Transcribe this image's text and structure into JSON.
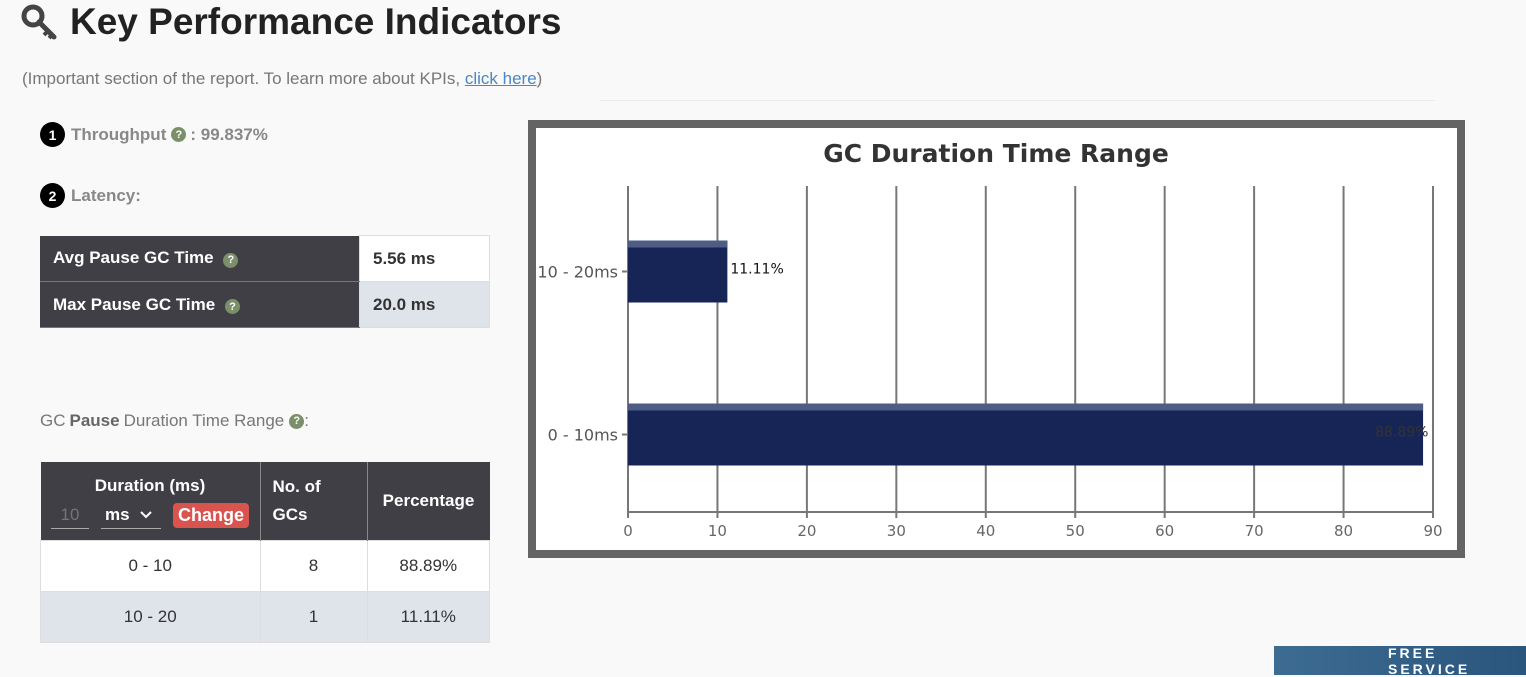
{
  "header": {
    "title": "Key Performance Indicators",
    "subtitle_prefix": "(Important section of the report. To learn more about KPIs, ",
    "subtitle_link": "click here",
    "subtitle_suffix": ")"
  },
  "kpi": {
    "throughput": {
      "index": "1",
      "label": "Throughput",
      "value": ": 99.837%"
    },
    "latency": {
      "index": "2",
      "label": "Latency:"
    }
  },
  "latency_table": [
    {
      "label": "Avg Pause GC Time",
      "value": "5.56 ms"
    },
    {
      "label": "Max Pause GC Time",
      "value": "20.0 ms"
    }
  ],
  "pause_range": {
    "label_pre": "GC",
    "label_bold": "Pause",
    "label_post": "Duration Time Range",
    "label_end": ":",
    "headers": {
      "duration": "Duration (ms)",
      "count": "No. of GCs",
      "percentage": "Percentage"
    },
    "interval_placeholder": "10",
    "unit": "ms",
    "change_label": "Change",
    "rows": [
      {
        "range": "0 - 10",
        "count": "8",
        "pct": "88.89%"
      },
      {
        "range": "10 - 20",
        "count": "1",
        "pct": "11.11%"
      }
    ]
  },
  "chart_data": {
    "type": "bar",
    "orientation": "horizontal",
    "title": "GC Duration Time Range",
    "categories": [
      "10 - 20ms",
      "0 - 10ms"
    ],
    "values": [
      11.11,
      88.89
    ],
    "data_labels": [
      "11.11%",
      "88.89%"
    ],
    "xlim": [
      0,
      90
    ],
    "xticks": [
      0,
      10,
      20,
      30,
      40,
      50,
      60,
      70,
      80,
      90
    ],
    "grid": true,
    "bar_color": "#172556"
  },
  "banner": {
    "text": "FREE SERVICE"
  },
  "colors": {
    "table_header": "#3f3f45",
    "change_button": "#d9534f",
    "link": "#4a86c5",
    "help_icon": "#7b8f6a"
  }
}
